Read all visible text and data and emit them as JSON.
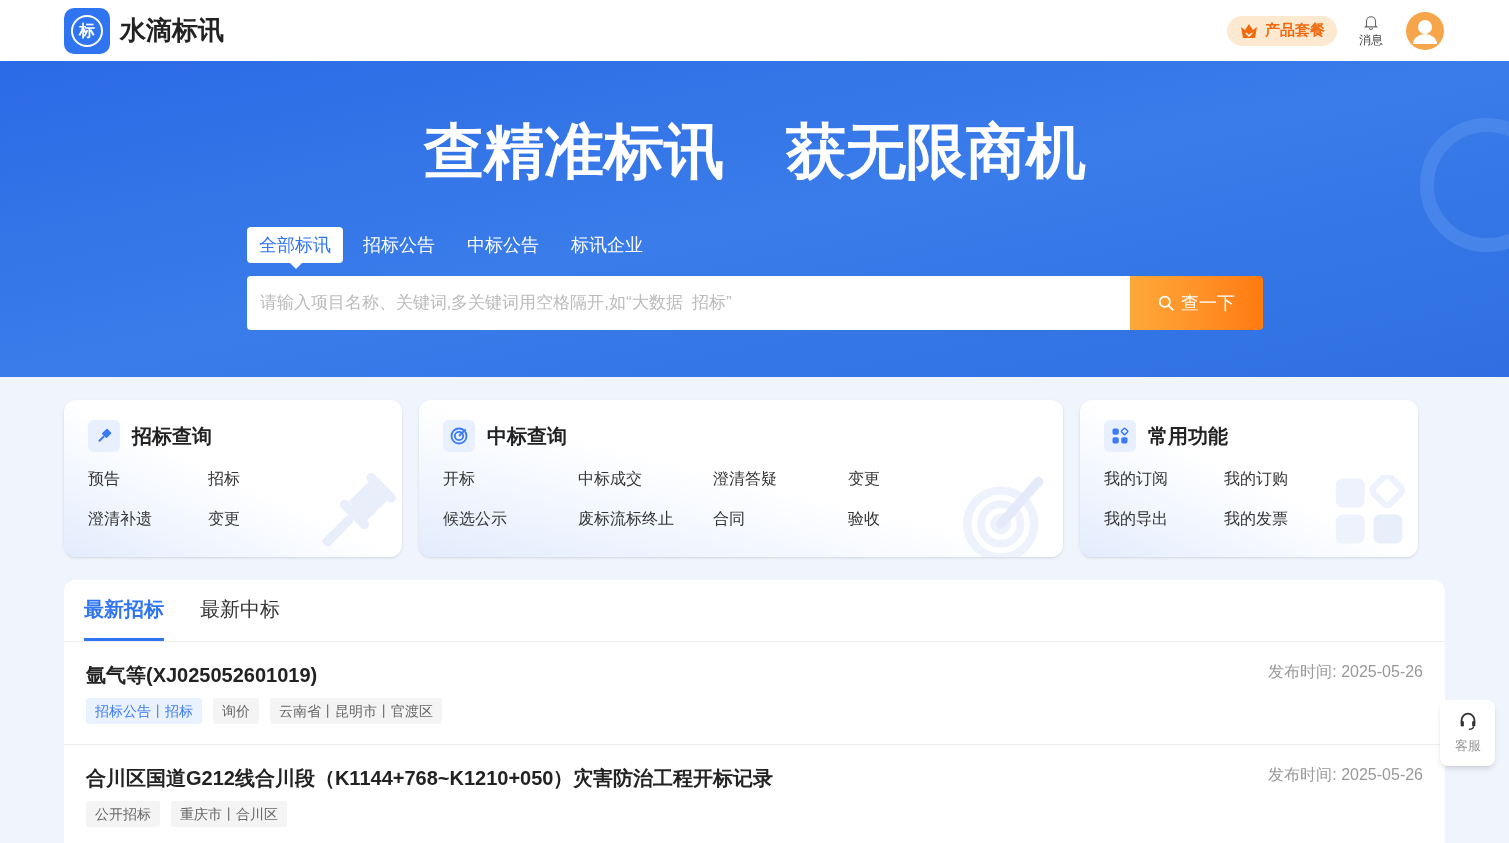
{
  "header": {
    "logo_mark": "标",
    "brand": "水滴标讯",
    "package_button": "产品套餐",
    "messages": "消息"
  },
  "hero": {
    "slogans": [
      "查精准标讯",
      "获无限商机"
    ],
    "search_tabs": [
      {
        "label": "全部标讯",
        "selected": true
      },
      {
        "label": "招标公告",
        "selected": false
      },
      {
        "label": "中标公告",
        "selected": false
      },
      {
        "label": "标讯企业",
        "selected": false
      }
    ],
    "search": {
      "placeholder": "请输入项目名称、关键词,多关键词用空格隔开,如“大数据  招标”",
      "button": "查一下"
    }
  },
  "cards": [
    {
      "kind": "gavel",
      "title": "招标查询",
      "items": [
        "预告",
        "招标",
        "澄清补遗",
        "变更"
      ]
    },
    {
      "kind": "target",
      "title": "中标查询",
      "items": [
        "开标",
        "中标成交",
        "澄清答疑",
        "变更",
        "候选公示",
        "废标流标终止",
        "合同",
        "验收"
      ]
    },
    {
      "kind": "apps",
      "title": "常用功能",
      "items": [
        "我的订阅",
        "我的订购",
        "我的导出",
        "我的发票"
      ]
    }
  ],
  "list": {
    "tabs": [
      {
        "label": "最新招标",
        "selected": true
      },
      {
        "label": "最新中标",
        "selected": false
      }
    ],
    "rows": [
      {
        "title": "氩气等(XJ025052601019)",
        "date": "发布时间: 2025-05-26",
        "tags": [
          {
            "kind": "category",
            "text": "招标公告丨招标"
          },
          {
            "kind": "plain",
            "text": "询价"
          },
          {
            "kind": "plain",
            "text": "云南省丨昆明市丨官渡区"
          }
        ]
      },
      {
        "title": "合川区国道G212线合川段（K1144+768~K1210+050）灾害防治工程开标记录",
        "date": "发布时间: 2025-05-26",
        "tags": [
          {
            "kind": "plain",
            "text": "公开招标"
          },
          {
            "kind": "plain",
            "text": "重庆市丨合川区"
          }
        ]
      }
    ]
  },
  "service": {
    "label": "客服"
  }
}
